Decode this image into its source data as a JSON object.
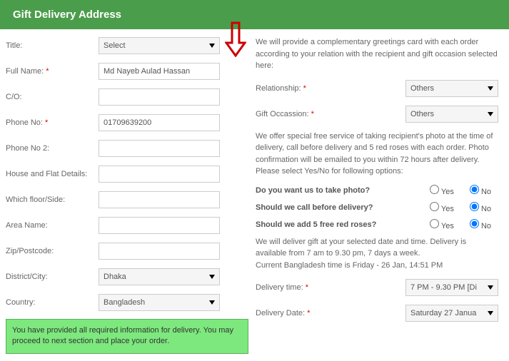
{
  "header": {
    "title": "Gift Delivery Address"
  },
  "left": {
    "title": {
      "label": "Title:",
      "value": "Select"
    },
    "fullname": {
      "label": "Full Name:",
      "req": "*",
      "value": "Md Nayeb Aulad Hassan"
    },
    "co": {
      "label": "C/O:",
      "value": ""
    },
    "phone": {
      "label": "Phone No:",
      "req": "*",
      "value": "01709639200"
    },
    "phone2": {
      "label": "Phone No 2:",
      "value": ""
    },
    "house": {
      "label": "House and Flat Details:",
      "value": ""
    },
    "floor": {
      "label": "Which floor/Side:",
      "value": ""
    },
    "area": {
      "label": "Area Name:",
      "value": ""
    },
    "zip": {
      "label": "Zip/Postcode:",
      "value": ""
    },
    "district": {
      "label": "District/City:",
      "value": "Dhaka"
    },
    "country": {
      "label": "Country:",
      "value": "Bangladesh"
    }
  },
  "right": {
    "intro": "We will provide a complementary greetings card with each order according to your relation with the recipient and gift occasion selected here:",
    "relationship": {
      "label": "Relationship:",
      "req": "*",
      "value": "Others"
    },
    "occasion": {
      "label": "Gift Occassion:",
      "req": "*",
      "value": "Others"
    },
    "info2": "We offer special free service of taking recipient's photo at the time of delivery, call before delivery and 5 red roses with each order. Photo confirmation will be emailed to you within 72 hours after delivery. Please select Yes/No for following options:",
    "q1": "Do you want us to take photo?",
    "q2": "Should we call before delivery?",
    "q3": "Should we add 5 free red roses?",
    "yes": "Yes",
    "no": "No",
    "info3a": "We will deliver gift at your selected date and time. Delivery is available from 7 am to 9.30 pm, 7 days a week.",
    "info3b": "Current Bangladesh time is Friday - 26 Jan, 14:51 PM",
    "deliverytime": {
      "label": "Delivery time:",
      "req": "*",
      "value": "7 PM - 9.30 PM [Di"
    },
    "deliverydate": {
      "label": "Delivery Date:",
      "req": "*",
      "value": "Saturday 27 Janua"
    }
  },
  "success": "You have provided all required information for delivery. You may proceed to next section and place your order."
}
